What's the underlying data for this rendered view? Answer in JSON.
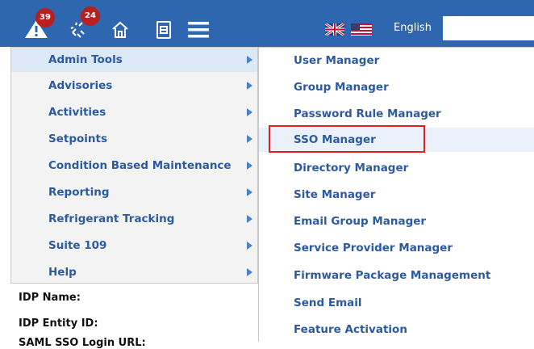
{
  "topbar": {
    "alerts_count": "39",
    "connections_count": "24",
    "language_label": "English",
    "search_value": ""
  },
  "menu": {
    "items": [
      {
        "label": "Admin Tools"
      },
      {
        "label": "Advisories"
      },
      {
        "label": "Activities"
      },
      {
        "label": "Setpoints"
      },
      {
        "label": "Condition Based Maintenance"
      },
      {
        "label": "Reporting"
      },
      {
        "label": "Refrigerant Tracking"
      },
      {
        "label": "Suite 109"
      },
      {
        "label": "Help"
      }
    ]
  },
  "submenu": {
    "items": [
      {
        "label": "User Manager"
      },
      {
        "label": "Group Manager"
      },
      {
        "label": "Password Rule Manager"
      },
      {
        "label": "SSO Manager"
      },
      {
        "label": "Directory Manager"
      },
      {
        "label": "Site Manager"
      },
      {
        "label": "Email Group Manager"
      },
      {
        "label": "Service Provider Manager"
      },
      {
        "label": "Firmware Package Management"
      },
      {
        "label": "Send Email"
      },
      {
        "label": "Feature Activation"
      }
    ]
  },
  "page": {
    "idp_name_label": "IDP Name:",
    "idp_entity_label": "IDP Entity ID:",
    "saml_label": "SAML SSO Login URL:"
  },
  "icons": {
    "alerts": "warning-icon",
    "connections": "broken-link-icon",
    "home": "home-icon",
    "reports": "document-icon",
    "menu": "hamburger-menu-icon",
    "flag_uk": "uk-flag-icon",
    "flag_us": "us-flag-icon"
  },
  "colors": {
    "topbar": "#2f66b0",
    "badge": "#b81f1f",
    "menu_text": "#2c5aa0",
    "highlight": "#e02020"
  }
}
